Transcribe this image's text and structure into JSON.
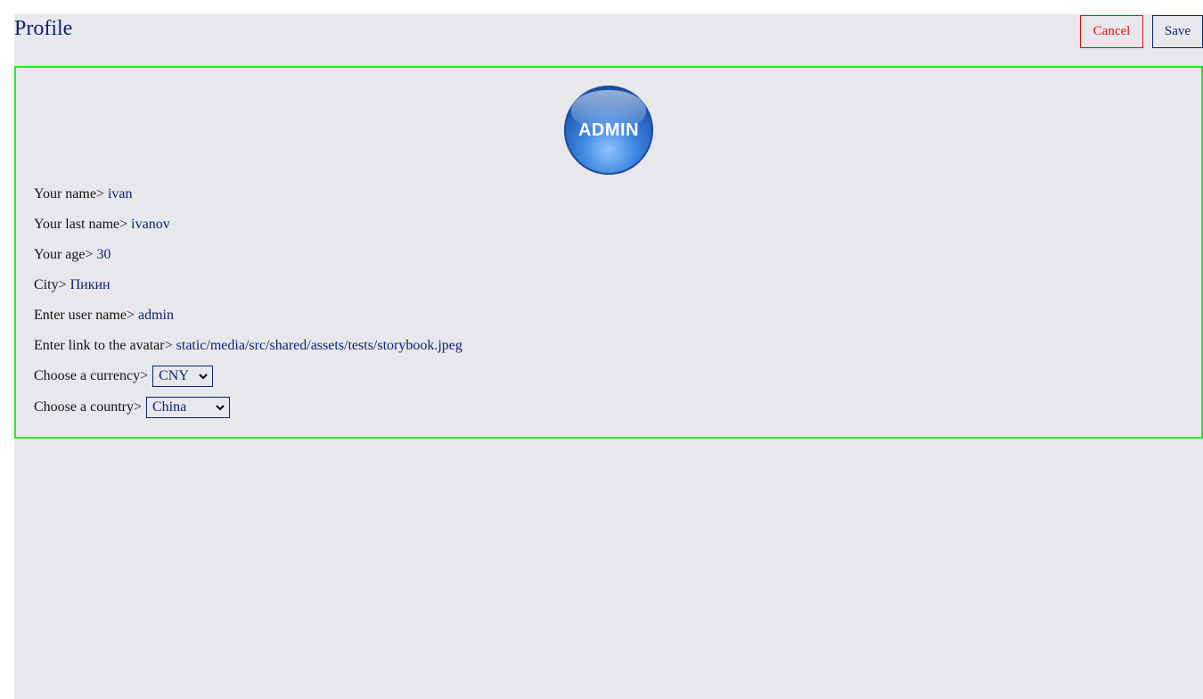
{
  "header": {
    "title": "Profile",
    "cancel_label": "Cancel",
    "save_label": "Save"
  },
  "avatar": {
    "text": "ADMIN"
  },
  "form": {
    "first_name": {
      "label": "Your name>",
      "value": "ivan"
    },
    "last_name": {
      "label": "Your last name>",
      "value": "ivanov"
    },
    "age": {
      "label": "Your age>",
      "value": "30"
    },
    "city": {
      "label": "City>",
      "value": "Пикин"
    },
    "username": {
      "label": "Enter user name>",
      "value": "admin"
    },
    "avatar_link": {
      "label": "Enter link to the avatar>",
      "value": "static/media/src/shared/assets/tests/storybook.jpeg"
    },
    "currency": {
      "label": "Choose a currency>",
      "selected": "CNY"
    },
    "country": {
      "label": "Choose a country>",
      "selected": "China"
    }
  },
  "colors": {
    "accent": "#0b2270",
    "cancel": "#e01010",
    "card_border": "#2ce62c",
    "page_background": "#e8e8ec"
  },
  "icons": {
    "select_arrow": "chevron-down-icon"
  }
}
